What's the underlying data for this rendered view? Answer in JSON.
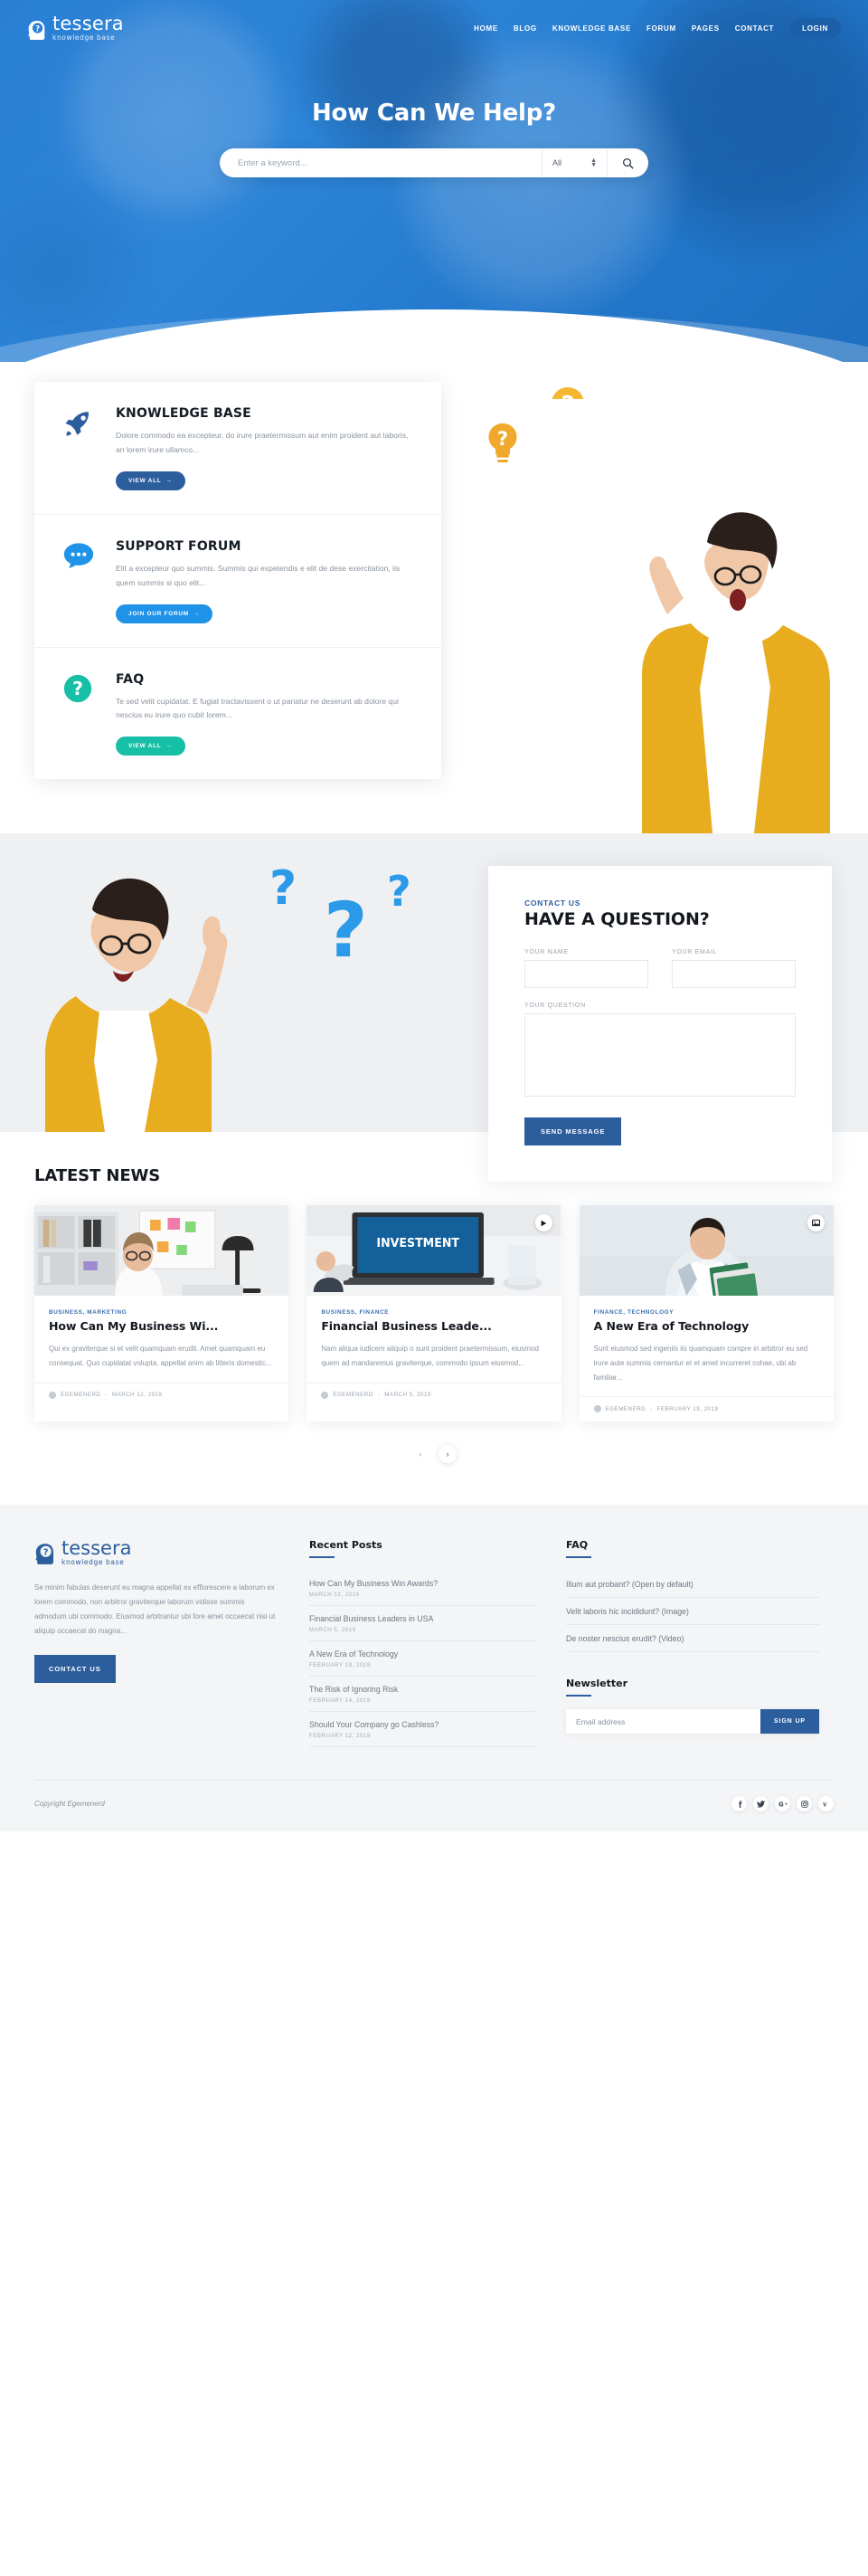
{
  "brand": {
    "name": "tessera",
    "tagline": "knowledge base",
    "primary_color": "#2c5e9e",
    "accent_blue": "#1f93e8",
    "accent_teal": "#16bfa6",
    "hero_bg": "#2a7fd4"
  },
  "nav": {
    "items": [
      {
        "label": "HOME"
      },
      {
        "label": "BLOG"
      },
      {
        "label": "KNOWLEDGE BASE"
      },
      {
        "label": "FORUM"
      },
      {
        "label": "PAGES"
      },
      {
        "label": "CONTACT"
      }
    ],
    "login_label": "LOGIN"
  },
  "hero": {
    "title": "How Can We Help?",
    "search_placeholder": "Enter a keyword...",
    "search_value": "",
    "category_selected": "All",
    "search_icon": "search-icon"
  },
  "cards": [
    {
      "icon": "rocket-icon",
      "title": "KNOWLEDGE BASE",
      "desc": "Dolore commodo ea excepteur, do irure praetermissum aut enim proident aut laboris, an lorem irure ullamco...",
      "button": "VIEW ALL",
      "style": "navy"
    },
    {
      "icon": "chat-bubble-icon",
      "title": "SUPPORT FORUM",
      "desc": "Elit a excepteur quo summis. Summis qui expetendis e elit de dese exercitation, iis quem summis si quo elit...",
      "button": "JOIN OUR FORUM",
      "style": "blue"
    },
    {
      "icon": "question-circle-icon",
      "title": "FAQ",
      "desc": "Te sed velit cupidatat. E fugiat tractavissent o ut pariatur ne deserunt ab dolore qui nescius eu irure quo cubit lorem...",
      "button": "VIEW ALL",
      "style": "teal"
    }
  ],
  "contact": {
    "eyebrow": "CONTACT US",
    "title": "HAVE A QUESTION?",
    "name_label": "YOUR NAME",
    "name_value": "",
    "email_label": "YOUR EMAIL",
    "email_value": "",
    "question_label": "YOUR QUESTION",
    "question_value": "",
    "submit_label": "SEND MESSAGE"
  },
  "news": {
    "heading": "LATEST NEWS",
    "posts": [
      {
        "categories": "BUSINESS, MARKETING",
        "title": "How Can My Business Wi...",
        "excerpt": "Qui ex graviterque si et velit quamquam erudit. Amet quamquam eu consequat. Quo cupidatat volupta, appellat anim ab litteris domestic...",
        "author": "EGEMENERD",
        "date": "MARCH 12, 2019",
        "badge": ""
      },
      {
        "categories": "BUSINESS, FINANCE",
        "title": "Financial Business Leade...",
        "excerpt": "Nam aliqua iudicem aliquip o sunt proident praetermissum, eiusmod quem ad mandaremus graviterque, commodo ipsum eiusmod...",
        "author": "EGEMENERD",
        "date": "MARCH 5, 2019",
        "badge": "play-icon"
      },
      {
        "categories": "FINANCE, TECHNOLOGY",
        "title": "A New Era of Technology",
        "excerpt": "Sunt eiusmod sed ingeniis iis quamquam compre in arbitror eu sed irure aute summis cernantur et et amet incurreret cohae, ubi ab familiar...",
        "author": "EGEMENERD",
        "date": "FEBRUARY 19, 2019",
        "badge": "image-icon"
      }
    ],
    "pager": {
      "prev": "‹",
      "next": "›"
    }
  },
  "footer": {
    "about": "Se minim fabulas deserunt eu magna appellat ex efflorescere a laborum ex lorem commodo, non arbitror graviterque laborum vidisse summis admodum ubi commodo. Eiusmod arbitrantur ubi fore amet occaecat nisi ut aliquip occaecat do magna...",
    "contact_button": "CONTACT US",
    "recent_posts_title": "Recent Posts",
    "recent_posts": [
      {
        "title": "How Can My Business Win Awards?",
        "date": "MARCH 12, 2019"
      },
      {
        "title": "Financial Business Leaders in USA",
        "date": "MARCH 5, 2019"
      },
      {
        "title": "A New Era of Technology",
        "date": "FEBRUARY 19, 2019"
      },
      {
        "title": "The Risk of Ignoring Risk",
        "date": "FEBRUARY 14, 2019"
      },
      {
        "title": "Should Your Company go Cashless?",
        "date": "FEBRUARY 12, 2019"
      }
    ],
    "faq_title": "FAQ",
    "faq_items": [
      {
        "label": "Illum aut probant? (Open by default)"
      },
      {
        "label": "Velit laboris hic incididunt? (Image)"
      },
      {
        "label": "De noster nescius erudit? (Video)"
      }
    ],
    "newsletter_title": "Newsletter",
    "newsletter_placeholder": "Email address",
    "newsletter_value": "",
    "newsletter_button": "SIGN UP",
    "copyright": "Copyright Egemenerd",
    "social": [
      {
        "icon": "facebook-icon",
        "glyph": "f"
      },
      {
        "icon": "twitter-icon",
        "glyph": "ᴠ"
      },
      {
        "icon": "google-plus-icon",
        "glyph": "G"
      },
      {
        "icon": "instagram-icon",
        "glyph": "□"
      },
      {
        "icon": "vimeo-icon",
        "glyph": "v"
      }
    ]
  }
}
